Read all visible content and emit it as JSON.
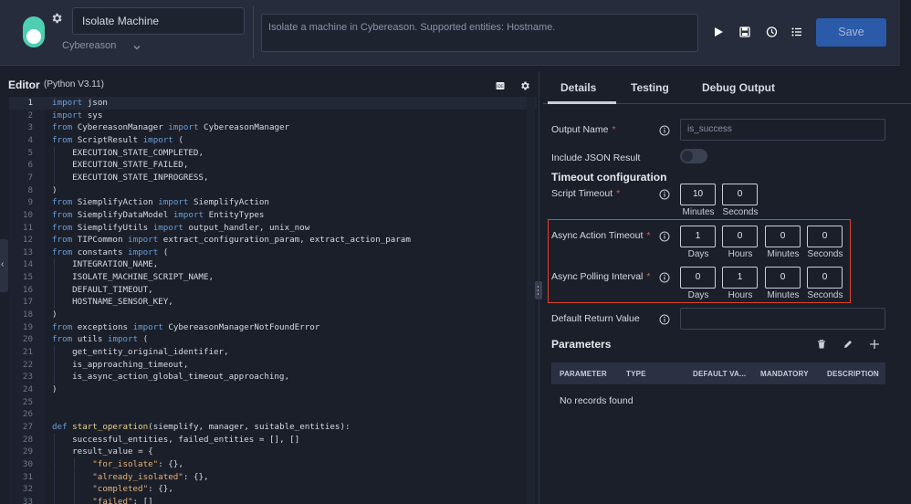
{
  "header": {
    "action_name": "Isolate Machine",
    "integration": "Cybereason",
    "description": "Isolate a machine in Cybereason. Supported entities: Hostname.",
    "save_label": "Save",
    "icons": [
      "gear-icon",
      "play-icon",
      "save-file-icon",
      "history-icon",
      "list-icon",
      "chevron-down-icon"
    ]
  },
  "editor": {
    "title": "Editor",
    "subtitle": "(Python V3.11)",
    "icons": [
      "ide-icon",
      "settings-icon"
    ],
    "lines": [
      "import json",
      "import sys",
      "from CybereasonManager import CybereasonManager",
      "from ScriptResult import (",
      "    EXECUTION_STATE_COMPLETED,",
      "    EXECUTION_STATE_FAILED,",
      "    EXECUTION_STATE_INPROGRESS,",
      ")",
      "from SiemplifyAction import SiemplifyAction",
      "from SiemplifyDataModel import EntityTypes",
      "from SiemplifyUtils import output_handler, unix_now",
      "from TIPCommon import extract_configuration_param, extract_action_param",
      "from constants import (",
      "    INTEGRATION_NAME,",
      "    ISOLATE_MACHINE_SCRIPT_NAME,",
      "    DEFAULT_TIMEOUT,",
      "    HOSTNAME_SENSOR_KEY,",
      ")",
      "from exceptions import CybereasonManagerNotFoundError",
      "from utils import (",
      "    get_entity_original_identifier,",
      "    is_approaching_timeout,",
      "    is_async_action_global_timeout_approaching,",
      ")",
      "",
      "",
      "def start_operation(siemplify, manager, suitable_entities):",
      "    successful_entities, failed_entities = [], []",
      "    result_value = {",
      "        \"for_isolate\": {},",
      "        \"already_isolated\": {},",
      "        \"completed\": {},",
      "        \"failed\": []"
    ]
  },
  "tabs": [
    "Details",
    "Testing",
    "Debug Output"
  ],
  "details": {
    "output_name_label": "Output Name",
    "output_name_value": "is_success",
    "include_json_label": "Include JSON Result",
    "include_json_on": false,
    "timeout_section": "Timeout configuration",
    "script_timeout_label": "Script Timeout",
    "script_timeout": [
      {
        "value": "10",
        "unit": "Minutes"
      },
      {
        "value": "0",
        "unit": "Seconds"
      }
    ],
    "async_timeout_label": "Async Action Timeout",
    "async_timeout": [
      {
        "value": "1",
        "unit": "Days"
      },
      {
        "value": "0",
        "unit": "Hours"
      },
      {
        "value": "0",
        "unit": "Minutes"
      },
      {
        "value": "0",
        "unit": "Seconds"
      }
    ],
    "async_polling_label": "Async Polling Interval",
    "async_polling": [
      {
        "value": "0",
        "unit": "Days"
      },
      {
        "value": "1",
        "unit": "Hours"
      },
      {
        "value": "0",
        "unit": "Minutes"
      },
      {
        "value": "0",
        "unit": "Seconds"
      }
    ],
    "default_return_label": "Default Return Value",
    "default_return_value": "",
    "required_mark": "*"
  },
  "parameters": {
    "title": "Parameters",
    "columns": [
      "PARAMETER",
      "TYPE",
      "DEFAULT VA...",
      "MANDATORY",
      "DESCRIPTION"
    ],
    "empty_text": "No records found",
    "icons": [
      "trash-icon",
      "edit-icon",
      "plus-icon"
    ]
  }
}
